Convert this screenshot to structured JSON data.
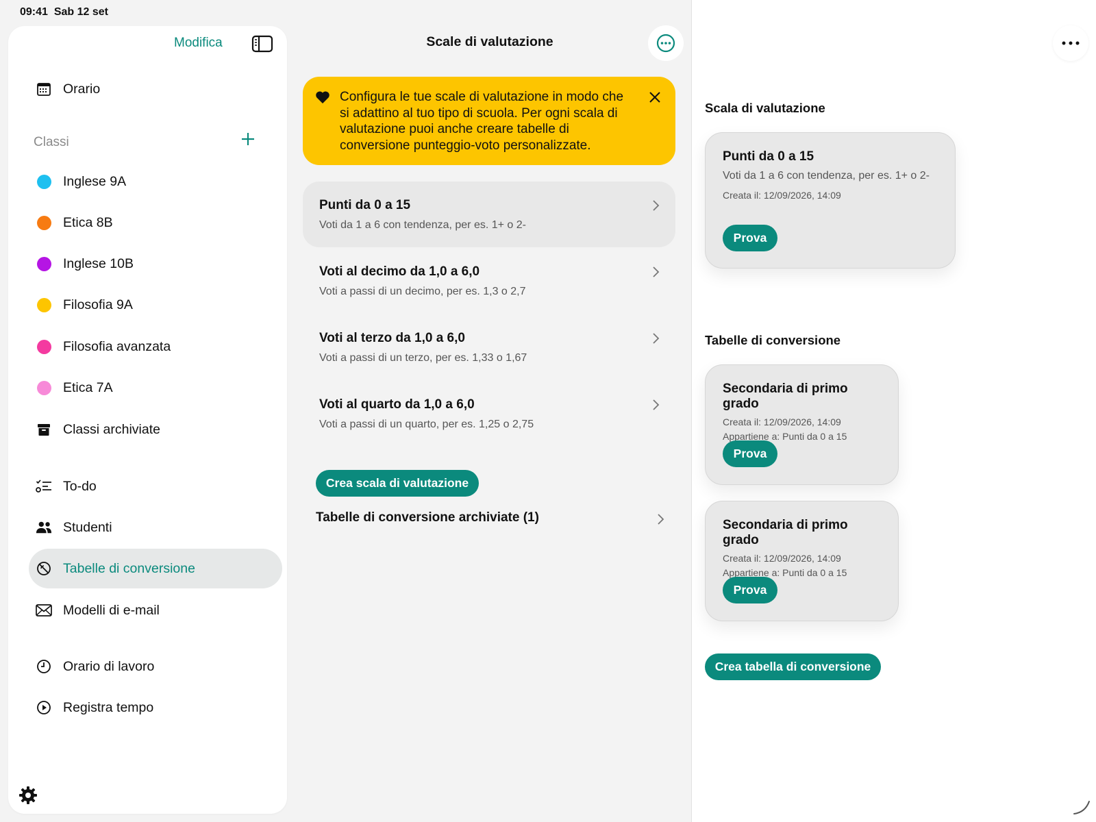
{
  "status": {
    "time": "09:41",
    "date": "Sab 12 set"
  },
  "sidebar": {
    "edit_label": "Modifica",
    "schedule": "Orario",
    "classes_header": "Classi",
    "classes": [
      {
        "label": "Inglese 9A",
        "color": "#1ec0f0"
      },
      {
        "label": "Etica 8B",
        "color": "#f77b12"
      },
      {
        "label": "Inglese 10B",
        "color": "#b515e4"
      },
      {
        "label": "Filosofia 9A",
        "color": "#fdc500"
      },
      {
        "label": "Filosofia avanzata",
        "color": "#f43aa0"
      },
      {
        "label": "Etica 7A",
        "color": "#f78ad8"
      }
    ],
    "archived_classes": "Classi archiviate",
    "todo": "To-do",
    "students": "Studenti",
    "conversion_tables": "Tabelle di conversione",
    "email_templates": "Modelli di e-mail",
    "work_hours": "Orario di lavoro",
    "track_time": "Registra tempo"
  },
  "middle": {
    "title": "Scale di valutazione",
    "banner_text": "Configura le tue scale di valutazione in modo che si adattino al tuo tipo di scuola. Per ogni scala di valutazione puoi anche creare tabelle di conversione punteggio-voto personalizzate.",
    "scales": [
      {
        "title": "Punti da 0 a 15",
        "subtitle": "Voti da 1 a 6 con tendenza, per es. 1+ o 2-"
      },
      {
        "title": "Voti al decimo da 1,0 a 6,0",
        "subtitle": "Voti a passi di un decimo, per es. 1,3 o 2,7"
      },
      {
        "title": "Voti al terzo da 1,0 a 6,0",
        "subtitle": "Voti a passi di un terzo, per es. 1,33 o 1,67"
      },
      {
        "title": "Voti al quarto da 1,0 a 6,0",
        "subtitle": "Voti a passi di un quarto, per es. 1,25 o 2,75"
      }
    ],
    "create_button": "Crea scala di valutazione",
    "archived_link": "Tabelle di conversione archiviate (1)"
  },
  "detail": {
    "scale_header": "Scala di valutazione",
    "scale_card": {
      "title": "Punti da 0 a 15",
      "subtitle": "Voti da 1 a 6 con tendenza, per es. 1+ o 2-",
      "created": "Creata il: 12/09/2026, 14:09",
      "button": "Prova"
    },
    "tables_header": "Tabelle di conversione",
    "tables": [
      {
        "title": "Secondaria di primo grado",
        "created": "Creata il: 12/09/2026, 14:09",
        "belongs": "Appartiene a: Punti da 0 a 15",
        "button": "Prova"
      },
      {
        "title": "Secondaria di primo grado",
        "created": "Creata il: 12/09/2026, 14:09",
        "belongs": "Appartiene a: Punti da 0 a 15",
        "button": "Prova"
      }
    ],
    "create_table_button": "Crea tabella di conversione"
  },
  "colors": {
    "accent": "#0b8a7d",
    "banner": "#fdc500"
  }
}
